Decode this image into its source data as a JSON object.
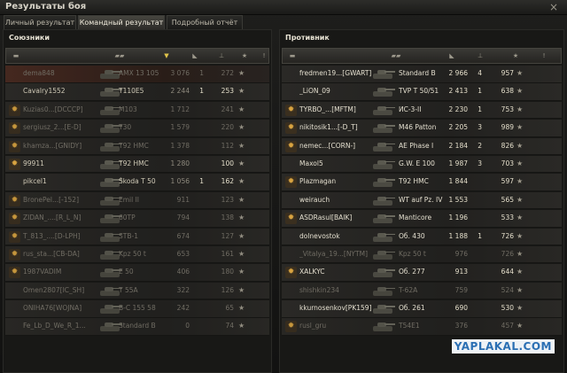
{
  "window": {
    "title": "Результаты боя",
    "close_icon": "×"
  },
  "tabs": [
    {
      "label": "Личный результат"
    },
    {
      "label": "Командный результат"
    },
    {
      "label": "Подробный отчёт"
    }
  ],
  "allies": {
    "title": "Союзники",
    "rows": [
      {
        "nick": "dema848",
        "vehicle": "AMX 13 105",
        "damage": "3 076",
        "kills": "1",
        "xp": "272",
        "badge": "",
        "me": true,
        "dead": true
      },
      {
        "nick": "Cavalry1552",
        "vehicle": "T110E5",
        "damage": "2 244",
        "kills": "1",
        "xp": "253",
        "badge": "",
        "dead": false
      },
      {
        "nick": "Kuzias0...[DCCCP]",
        "vehicle": "M103",
        "damage": "1 712",
        "kills": "",
        "xp": "241",
        "badge": "star",
        "dead": true
      },
      {
        "nick": "sergiusz_2...[E-D]",
        "vehicle": "T30",
        "damage": "1 579",
        "kills": "",
        "xp": "220",
        "badge": "star",
        "dead": true
      },
      {
        "nick": "khamza...[GNIDY]",
        "vehicle": "T92 HMC",
        "damage": "1 378",
        "kills": "",
        "xp": "112",
        "badge": "star",
        "dead": true
      },
      {
        "nick": "99911",
        "vehicle": "T92 HMC",
        "damage": "1 280",
        "kills": "",
        "xp": "100",
        "badge": "star",
        "dead": false
      },
      {
        "nick": "pikcel1",
        "vehicle": "Škoda T 50",
        "damage": "1 056",
        "kills": "1",
        "xp": "162",
        "badge": "",
        "dead": false
      },
      {
        "nick": "BronePel...[-152]",
        "vehicle": "Emil II",
        "damage": "911",
        "kills": "",
        "xp": "123",
        "badge": "star",
        "dead": true
      },
      {
        "nick": "ZIDAN_....[R_L_N]",
        "vehicle": "60TP",
        "damage": "794",
        "kills": "",
        "xp": "138",
        "badge": "star",
        "dead": true
      },
      {
        "nick": "T_813_....[D-LPH]",
        "vehicle": "STB-1",
        "damage": "674",
        "kills": "",
        "xp": "127",
        "badge": "star",
        "dead": true
      },
      {
        "nick": "rus_sta...[CB-DA]",
        "vehicle": "Kpz 50 t",
        "damage": "653",
        "kills": "",
        "xp": "161",
        "badge": "star",
        "dead": true
      },
      {
        "nick": "1987VADIM",
        "vehicle": "E 50",
        "damage": "406",
        "kills": "",
        "xp": "180",
        "badge": "star",
        "dead": true
      },
      {
        "nick": "Omen2807[IC_SH]",
        "vehicle": "T 55A",
        "damage": "322",
        "kills": "",
        "xp": "126",
        "badge": "",
        "dead": true
      },
      {
        "nick": "ONIHA76[WOJNA]",
        "vehicle": "B-C 155 58",
        "damage": "242",
        "kills": "",
        "xp": "65",
        "badge": "",
        "dead": true
      },
      {
        "nick": "Fe_Lb_D_We_R_1...",
        "vehicle": "Standard B",
        "damage": "0",
        "kills": "",
        "xp": "74",
        "badge": "",
        "dead": true
      }
    ]
  },
  "enemy": {
    "title": "Противник",
    "rows": [
      {
        "nick": "fredmen19...[GWART]",
        "vehicle": "Standard B",
        "damage": "2 966",
        "kills": "4",
        "xp": "957",
        "badge": "",
        "dead": false
      },
      {
        "nick": "_LiON_09",
        "vehicle": "TVP T 50/51",
        "damage": "2 413",
        "kills": "1",
        "xp": "638",
        "badge": "",
        "dead": false
      },
      {
        "nick": "TYRBO_...[MFTM]",
        "vehicle": "ИС-3-II",
        "damage": "2 230",
        "kills": "1",
        "xp": "753",
        "badge": "star",
        "dead": false
      },
      {
        "nick": "nikitosik1...[-D_T]",
        "vehicle": "M46 Patton",
        "damage": "2 205",
        "kills": "3",
        "xp": "989",
        "badge": "star",
        "dead": false
      },
      {
        "nick": "nemec...[CORN-]",
        "vehicle": "AE Phase I",
        "damage": "2 184",
        "kills": "2",
        "xp": "826",
        "badge": "star",
        "dead": false
      },
      {
        "nick": "Maxol5",
        "vehicle": "G.W. E 100",
        "damage": "1 987",
        "kills": "3",
        "xp": "703",
        "badge": "",
        "dead": false
      },
      {
        "nick": "Plazmagan",
        "vehicle": "T92 HMC",
        "damage": "1 844",
        "kills": "",
        "xp": "597",
        "badge": "star",
        "dead": false
      },
      {
        "nick": "weirauch",
        "vehicle": "WT auf Pz. IV",
        "damage": "1 553",
        "kills": "",
        "xp": "565",
        "badge": "",
        "dead": false
      },
      {
        "nick": "ASDRasul[BAIK]",
        "vehicle": "Manticore",
        "damage": "1 196",
        "kills": "",
        "xp": "533",
        "badge": "star",
        "dead": false
      },
      {
        "nick": "dolnevostok",
        "vehicle": "Об. 430",
        "damage": "1 188",
        "kills": "1",
        "xp": "726",
        "badge": "",
        "dead": false
      },
      {
        "nick": "_Vitalya_19...[NYTM]",
        "vehicle": "Kpz 50 t",
        "damage": "976",
        "kills": "",
        "xp": "726",
        "badge": "",
        "dead": true
      },
      {
        "nick": "XALKYC",
        "vehicle": "Об. 277",
        "damage": "913",
        "kills": "",
        "xp": "644",
        "badge": "star",
        "dead": false
      },
      {
        "nick": "shishkin234",
        "vehicle": "T-62A",
        "damage": "759",
        "kills": "",
        "xp": "524",
        "badge": "",
        "dead": true
      },
      {
        "nick": "kkurnosenkov[PK159]",
        "vehicle": "Об. 261",
        "damage": "690",
        "kills": "",
        "xp": "530",
        "badge": "",
        "dead": false
      },
      {
        "nick": "rusl_gru",
        "vehicle": "T54E1",
        "damage": "376",
        "kills": "",
        "xp": "457",
        "badge": "star",
        "dead": true
      }
    ]
  },
  "watermark": "YAPLAKAL.COM"
}
